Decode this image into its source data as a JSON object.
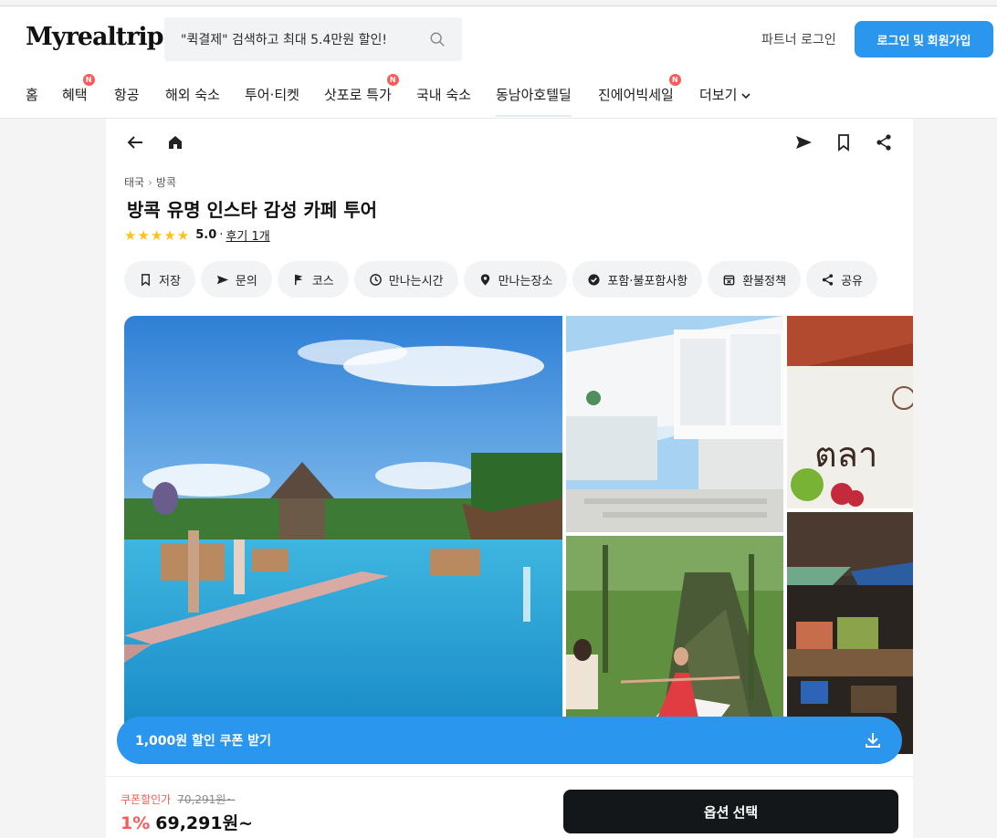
{
  "header": {
    "logo": "Myrealtrip",
    "search_placeholder": "\"퀵결제\" 검색하고 최대 5.4만원 할인!",
    "partner_login": "파트너 로그인",
    "login_signup": "로그인 및 회원가입"
  },
  "nav": {
    "items": [
      {
        "label": "홈",
        "badge": ""
      },
      {
        "label": "혜택",
        "badge": "N"
      },
      {
        "label": "항공",
        "badge": ""
      },
      {
        "label": "해외 숙소",
        "badge": ""
      },
      {
        "label": "투어·티켓",
        "badge": ""
      },
      {
        "label": "삿포로 특가",
        "badge": "N"
      },
      {
        "label": "국내 숙소",
        "badge": ""
      },
      {
        "label": "동남아호텔딜",
        "badge": ""
      },
      {
        "label": "진에어빅세일",
        "badge": "N"
      },
      {
        "label": "더보기",
        "badge": ""
      }
    ]
  },
  "product": {
    "breadcrumb": [
      "태국",
      "방콕"
    ],
    "title": "방콕 유명 인스타 감성 카페 투어",
    "stars": "★★★★★",
    "rating": "5.0",
    "rating_sep": "·",
    "reviews": "후기 1개"
  },
  "chips": [
    "저장",
    "문의",
    "코스",
    "만나는시간",
    "만나는장소",
    "포함·불포함사항",
    "환불정책",
    "공유"
  ],
  "coupon_bar": {
    "label": "1,000원 할인 쿠폰 받기"
  },
  "purchase": {
    "coupon_price_label": "쿠폰할인가",
    "original_price": "70,291원~",
    "discount": "1%",
    "final_price": "69,291원~",
    "option_button": "옵션 선택"
  },
  "colors": {
    "primary": "#2b96ed",
    "discount_red": "#fc5a5a",
    "star": "#ffc21c",
    "dark_button": "#141719"
  }
}
